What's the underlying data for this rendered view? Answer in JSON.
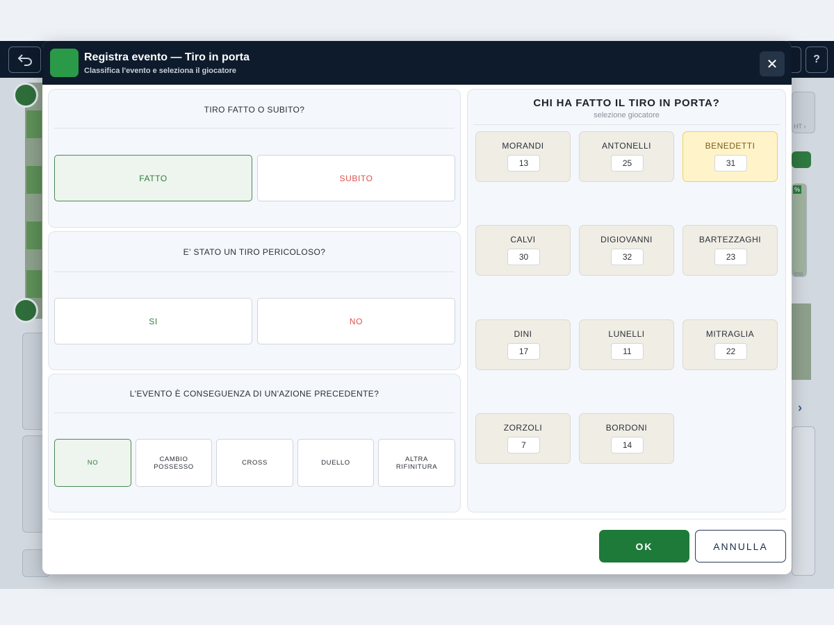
{
  "background": {
    "back_icon": "undo-arrow-icon",
    "help_label": "?",
    "side_labels": [
      "HT ›",
      "%",
      "losi"
    ]
  },
  "modal": {
    "title": "Registra evento — Tiro in porta",
    "subtitle": "Classifica l'evento e seleziona il giocatore",
    "close_icon": "close-icon",
    "close_glyph": "✕",
    "questions": [
      {
        "title": "TIRO FATTO O SUBITO?",
        "options": [
          {
            "label": "FATTO",
            "selected": true
          },
          {
            "label": "SUBITO",
            "selected": false
          }
        ]
      },
      {
        "title": "E' STATO UN TIRO PERICOLOSO?",
        "options": [
          {
            "label": "SI",
            "selected": false
          },
          {
            "label": "NO",
            "selected": false
          }
        ]
      },
      {
        "title": "L'EVENTO È CONSEGUENZA DI UN'AZIONE PRECEDENTE?",
        "options": [
          {
            "label": "NO",
            "selected": true
          },
          {
            "label": "CAMBIO\nPOSSESSO",
            "selected": false
          },
          {
            "label": "CROSS",
            "selected": false
          },
          {
            "label": "DUELLO",
            "selected": false
          },
          {
            "label": "ALTRA\nRIFINITURA",
            "selected": false
          }
        ]
      }
    ],
    "player_panel": {
      "title": "CHI HA FATTO IL TIRO IN PORTA?",
      "subtitle": "selezione giocatore",
      "players": [
        {
          "name": "MORANDI",
          "number": "13",
          "selected": false
        },
        {
          "name": "ANTONELLI",
          "number": "25",
          "selected": false
        },
        {
          "name": "BENEDETTI",
          "number": "31",
          "selected": true
        },
        {
          "name": "CALVI",
          "number": "30",
          "selected": false
        },
        {
          "name": "DIGIOVANNI",
          "number": "32",
          "selected": false
        },
        {
          "name": "BARTEZZAGHI",
          "number": "23",
          "selected": false
        },
        {
          "name": "DINI",
          "number": "17",
          "selected": false
        },
        {
          "name": "LUNELLI",
          "number": "11",
          "selected": false
        },
        {
          "name": "MITRAGLIA",
          "number": "22",
          "selected": false
        },
        {
          "name": "ZORZOLI",
          "number": "7",
          "selected": false
        },
        {
          "name": "BORDONI",
          "number": "14",
          "selected": false
        }
      ]
    },
    "footer": {
      "ok_label": "OK",
      "cancel_label": "ANNULLA"
    }
  },
  "colors": {
    "header_bg": "#0e1b2c",
    "accent_green": "#1d7a39",
    "danger_red": "#e0514a",
    "selected_player": "#fff4c9"
  }
}
